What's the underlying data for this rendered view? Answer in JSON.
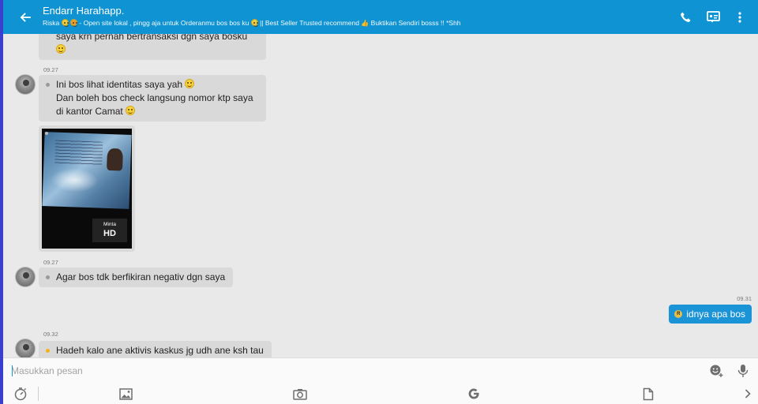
{
  "header": {
    "title": "Endarr Harahapp.",
    "subtitle_prefix": "Riska",
    "subtitle_text": " - Open site lokal , pingg aja untuk Orderanmu bos bos ku ",
    "subtitle_suffix": " || Best Seller Trusted recommend ",
    "subtitle_end": " Buktikan Sendiri bosss !! *Shh"
  },
  "messages": {
    "m0": {
      "text": "saya krn pernah bertransaksi dgn saya bosku"
    },
    "m1": {
      "time": "09.27",
      "line1": "Ini bos lihat identitas saya yah ",
      "line2": "Dan boleh bos check langsung nomor ktp saya",
      "line3": "di kantor Camat "
    },
    "photo": {
      "badge_small": "Minta",
      "badge_big": "HD"
    },
    "m2": {
      "time": "09.27",
      "text": "Agar bos tdk berfikiran negativ dgn saya"
    },
    "out1": {
      "time": "09.31",
      "icon_letter": "R",
      "text": "idnya apa bos"
    },
    "m3": {
      "time": "09.32",
      "text": "Hadeh kalo ane aktivis kaskus jg udh ane ksh tau"
    }
  },
  "composer": {
    "placeholder": "Masukkan pesan",
    "value": ""
  },
  "colors": {
    "header": "#0f93d2",
    "outgoing": "#1a93d7",
    "incoming": "#d9d9d9",
    "background": "#e9e9e9"
  },
  "icons": {
    "back": "arrow-left-icon",
    "call": "phone-icon",
    "profile": "id-card-icon",
    "more": "more-vertical-icon",
    "emoji": "emoji-add-icon",
    "mic": "microphone-icon",
    "timer": "timer-icon",
    "gallery": "image-icon",
    "camera": "camera-icon",
    "google": "google-icon",
    "file": "file-icon",
    "next": "chevron-right-icon"
  }
}
